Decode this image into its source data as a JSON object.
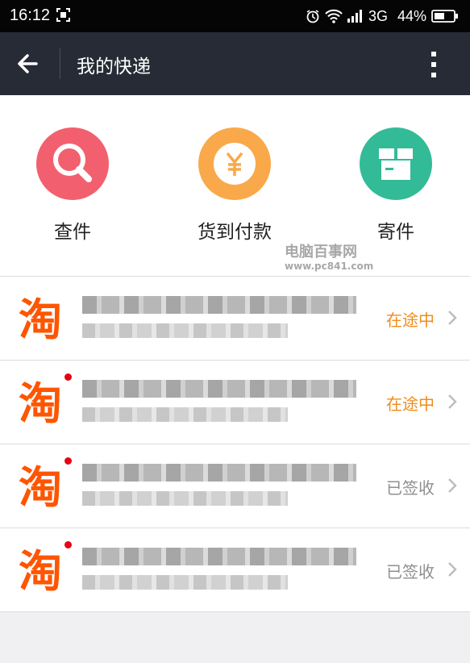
{
  "status_bar": {
    "time": "16:12",
    "network": "3G",
    "battery": "44%"
  },
  "header": {
    "title": "我的快递"
  },
  "quick_actions": [
    {
      "label": "查件",
      "color": "#f2606f",
      "icon": "search-icon"
    },
    {
      "label": "货到付款",
      "color": "#f9a94a",
      "icon": "yen-icon"
    },
    {
      "label": "寄件",
      "color": "#33bb98",
      "icon": "box-icon"
    }
  ],
  "watermark": {
    "line1": "电脑百事网",
    "line2": "www.pc841.com"
  },
  "parcels": [
    {
      "logo": "淘",
      "status": "在途中",
      "status_color": "#f08c1c",
      "unread": false
    },
    {
      "logo": "淘",
      "status": "在途中",
      "status_color": "#f08c1c",
      "unread": true
    },
    {
      "logo": "淘",
      "status": "已签收",
      "status_color": "#8f8f8f",
      "unread": true
    },
    {
      "logo": "淘",
      "status": "已签收",
      "status_color": "#8f8f8f",
      "unread": true
    }
  ]
}
